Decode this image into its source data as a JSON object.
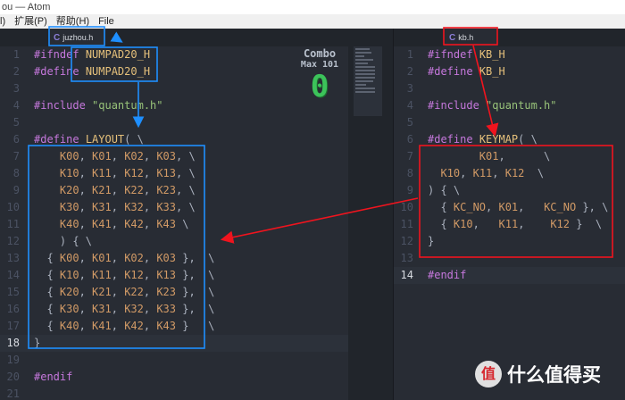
{
  "window": {
    "title": "ou — Atom"
  },
  "menu": [
    "l)",
    "扩展(P)",
    "帮助(H)",
    "File"
  ],
  "tabs": {
    "left": {
      "icon": "C",
      "label": "juzhou.h"
    },
    "right": {
      "icon": "C",
      "label": "kb.h"
    }
  },
  "left_editor": {
    "current_line": 18,
    "lines": [
      [
        [
          "kw",
          "#ifndef"
        ],
        [
          "pn",
          " "
        ],
        [
          "mac",
          "NUMPAD20_H"
        ]
      ],
      [
        [
          "kw",
          "#define"
        ],
        [
          "pn",
          " "
        ],
        [
          "mac",
          "NUMPAD20_H"
        ]
      ],
      [],
      [
        [
          "kw",
          "#include"
        ],
        [
          "pn",
          " "
        ],
        [
          "str",
          "\"quantum.h\""
        ]
      ],
      [],
      [
        [
          "kw",
          "#define"
        ],
        [
          "pn",
          " "
        ],
        [
          "mac",
          "LAYOUT"
        ],
        [
          "pn",
          "( \\"
        ]
      ],
      [
        [
          "pn",
          "    "
        ],
        [
          "id",
          "K00"
        ],
        [
          "pn",
          ", "
        ],
        [
          "id",
          "K01"
        ],
        [
          "pn",
          ", "
        ],
        [
          "id",
          "K02"
        ],
        [
          "pn",
          ", "
        ],
        [
          "id",
          "K03"
        ],
        [
          "pn",
          ", \\"
        ]
      ],
      [
        [
          "pn",
          "    "
        ],
        [
          "id",
          "K10"
        ],
        [
          "pn",
          ", "
        ],
        [
          "id",
          "K11"
        ],
        [
          "pn",
          ", "
        ],
        [
          "id",
          "K12"
        ],
        [
          "pn",
          ", "
        ],
        [
          "id",
          "K13"
        ],
        [
          "pn",
          ", \\"
        ]
      ],
      [
        [
          "pn",
          "    "
        ],
        [
          "id",
          "K20"
        ],
        [
          "pn",
          ", "
        ],
        [
          "id",
          "K21"
        ],
        [
          "pn",
          ", "
        ],
        [
          "id",
          "K22"
        ],
        [
          "pn",
          ", "
        ],
        [
          "id",
          "K23"
        ],
        [
          "pn",
          ", \\"
        ]
      ],
      [
        [
          "pn",
          "    "
        ],
        [
          "id",
          "K30"
        ],
        [
          "pn",
          ", "
        ],
        [
          "id",
          "K31"
        ],
        [
          "pn",
          ", "
        ],
        [
          "id",
          "K32"
        ],
        [
          "pn",
          ", "
        ],
        [
          "id",
          "K33"
        ],
        [
          "pn",
          ", \\"
        ]
      ],
      [
        [
          "pn",
          "    "
        ],
        [
          "id",
          "K40"
        ],
        [
          "pn",
          ", "
        ],
        [
          "id",
          "K41"
        ],
        [
          "pn",
          ", "
        ],
        [
          "id",
          "K42"
        ],
        [
          "pn",
          ", "
        ],
        [
          "id",
          "K43"
        ],
        [
          "pn",
          " \\"
        ]
      ],
      [
        [
          "pn",
          "    ) { \\"
        ]
      ],
      [
        [
          "pn",
          "  { "
        ],
        [
          "id",
          "K00"
        ],
        [
          "pn",
          ", "
        ],
        [
          "id",
          "K01"
        ],
        [
          "pn",
          ", "
        ],
        [
          "id",
          "K02"
        ],
        [
          "pn",
          ", "
        ],
        [
          "id",
          "K03"
        ],
        [
          "pn",
          " },  \\"
        ]
      ],
      [
        [
          "pn",
          "  { "
        ],
        [
          "id",
          "K10"
        ],
        [
          "pn",
          ", "
        ],
        [
          "id",
          "K11"
        ],
        [
          "pn",
          ", "
        ],
        [
          "id",
          "K12"
        ],
        [
          "pn",
          ", "
        ],
        [
          "id",
          "K13"
        ],
        [
          "pn",
          " },  \\"
        ]
      ],
      [
        [
          "pn",
          "  { "
        ],
        [
          "id",
          "K20"
        ],
        [
          "pn",
          ", "
        ],
        [
          "id",
          "K21"
        ],
        [
          "pn",
          ", "
        ],
        [
          "id",
          "K22"
        ],
        [
          "pn",
          ", "
        ],
        [
          "id",
          "K23"
        ],
        [
          "pn",
          " },  \\"
        ]
      ],
      [
        [
          "pn",
          "  { "
        ],
        [
          "id",
          "K30"
        ],
        [
          "pn",
          ", "
        ],
        [
          "id",
          "K31"
        ],
        [
          "pn",
          ", "
        ],
        [
          "id",
          "K32"
        ],
        [
          "pn",
          ", "
        ],
        [
          "id",
          "K33"
        ],
        [
          "pn",
          " },  \\"
        ]
      ],
      [
        [
          "pn",
          "  { "
        ],
        [
          "id",
          "K40"
        ],
        [
          "pn",
          ", "
        ],
        [
          "id",
          "K41"
        ],
        [
          "pn",
          ", "
        ],
        [
          "id",
          "K42"
        ],
        [
          "pn",
          ", "
        ],
        [
          "id",
          "K43"
        ],
        [
          "pn",
          " }   \\"
        ]
      ],
      [
        [
          "pn",
          "}"
        ]
      ],
      [],
      [
        [
          "kw",
          "#endif"
        ]
      ],
      []
    ]
  },
  "right_editor": {
    "current_line": 14,
    "lines": [
      [
        [
          "kw",
          "#ifndef"
        ],
        [
          "pn",
          " "
        ],
        [
          "mac",
          "KB_H"
        ]
      ],
      [
        [
          "kw",
          "#define"
        ],
        [
          "pn",
          " "
        ],
        [
          "mac",
          "KB_H"
        ]
      ],
      [],
      [
        [
          "kw",
          "#include"
        ],
        [
          "pn",
          " "
        ],
        [
          "str",
          "\"quantum.h\""
        ]
      ],
      [],
      [
        [
          "kw",
          "#define"
        ],
        [
          "pn",
          " "
        ],
        [
          "mac",
          "KEYMAP"
        ],
        [
          "pn",
          "( \\"
        ]
      ],
      [
        [
          "pn",
          "        "
        ],
        [
          "id",
          "K01"
        ],
        [
          "pn",
          ",      \\"
        ]
      ],
      [
        [
          "pn",
          "  "
        ],
        [
          "id",
          "K10"
        ],
        [
          "pn",
          ", "
        ],
        [
          "id",
          "K11"
        ],
        [
          "pn",
          ", "
        ],
        [
          "id",
          "K12"
        ],
        [
          "pn",
          "  \\"
        ]
      ],
      [
        [
          "pn",
          ") { \\"
        ]
      ],
      [
        [
          "pn",
          "  { "
        ],
        [
          "id",
          "KC_NO"
        ],
        [
          "pn",
          ", "
        ],
        [
          "id",
          "K01"
        ],
        [
          "pn",
          ",   "
        ],
        [
          "id",
          "KC_NO"
        ],
        [
          "pn",
          " }, \\"
        ]
      ],
      [
        [
          "pn",
          "  { "
        ],
        [
          "id",
          "K10"
        ],
        [
          "pn",
          ",   "
        ],
        [
          "id",
          "K11"
        ],
        [
          "pn",
          ",    "
        ],
        [
          "id",
          "K12"
        ],
        [
          "pn",
          " }  \\"
        ]
      ],
      [
        [
          "pn",
          "}"
        ]
      ],
      [],
      [
        [
          "kw",
          "#endif"
        ]
      ]
    ]
  },
  "combo": {
    "title": "Combo",
    "subtitle": "Max 101",
    "count": "0"
  },
  "watermark": {
    "logo": "值",
    "text": "什么值得买"
  },
  "colors": {
    "annotation_blue": "#1e8fff",
    "annotation_red": "#f0141e"
  }
}
